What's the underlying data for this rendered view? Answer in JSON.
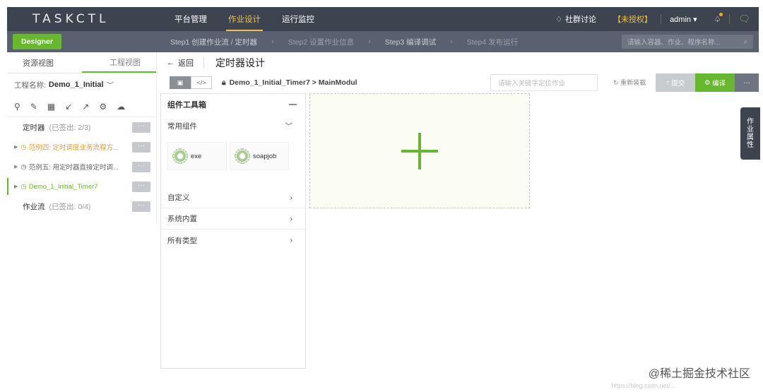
{
  "topbar": {
    "logo": "TASKCTL",
    "nav": [
      "平台管理",
      "作业设计",
      "运行监控"
    ],
    "community": "社群讨论",
    "unauthorized": "【未授权】",
    "user": "admin ▾"
  },
  "stepbar": {
    "designer": "Designer",
    "steps": [
      "Step1 创建作业流 / 定时器",
      "Step2 设置作业信息",
      "Step3 编译调试",
      "Step4 发布运行"
    ],
    "search_placeholder": "请输入容器、作业、程序名称..."
  },
  "left": {
    "tabs": [
      "资源视图",
      "工程视图"
    ],
    "project_label": "工程名称:",
    "project_value": "Demo_1_Initial",
    "timer_label": "定时器",
    "timer_sub": "(已签出: 2/3)",
    "items": [
      "范例四: 定时调度业务流程方...",
      "范例五: 用定时器直接定时调...",
      "Demo_1_Initial_Timer7"
    ],
    "flow_label": "作业流",
    "flow_sub": "(已签出: 0/4)",
    "more": "···"
  },
  "main": {
    "back": "返回",
    "title": "定时器设计",
    "crumb": "Demo_1_Initial_Timer7 > MainModul",
    "locate_placeholder": "请输入关键字定位作业",
    "reload": "重新装载",
    "submit": "提交",
    "compile": "编译",
    "more": "···"
  },
  "toolbox": {
    "title": "组件工具箱",
    "common": "常用组件",
    "items": [
      "exe",
      "soapjob"
    ],
    "sections": [
      "自定义",
      "系统内置",
      "所有类型"
    ]
  },
  "proptab": [
    "作",
    "业",
    "属",
    "性"
  ],
  "watermark": "@稀土掘金技术社区",
  "watermark_url": "https://blog.csdn.net/..."
}
